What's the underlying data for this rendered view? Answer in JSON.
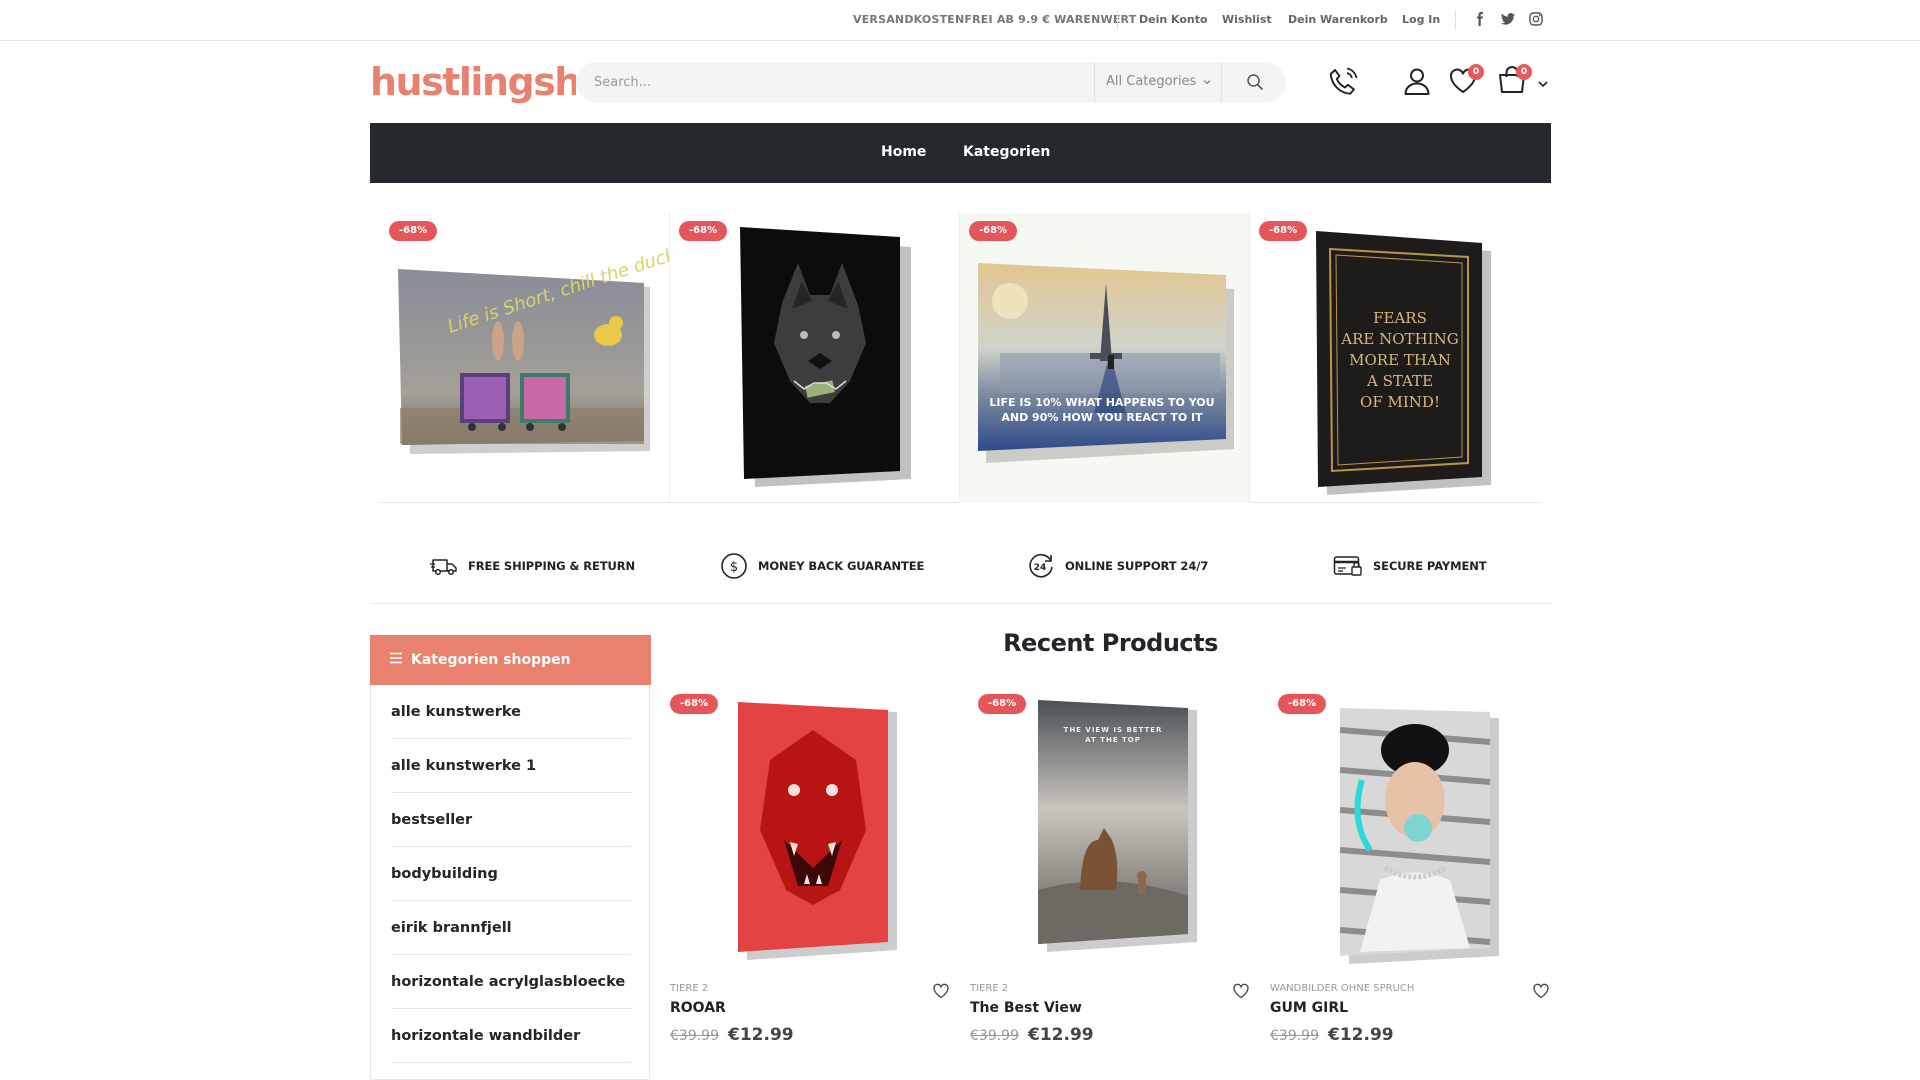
{
  "topbar": {
    "shipping_note": "VERSANDKOSTENFREI AB 9.9 € WARENWERT",
    "links": [
      "Dein Konto",
      "Wishlist",
      "Dein Warenkorb",
      "Log In"
    ],
    "social": [
      "facebook-icon",
      "twitter-icon",
      "instagram-icon"
    ]
  },
  "header": {
    "logo": "hustlingsha",
    "search_placeholder": "Search...",
    "category_select": "All Categories",
    "wishlist_count": "0",
    "cart_count": "0"
  },
  "nav": {
    "items": [
      "Home",
      "Kategorien"
    ]
  },
  "top_products": [
    {
      "badge": "-68%",
      "art": "Life is Short, chill the duck out"
    },
    {
      "badge": "-68%",
      "art": ""
    },
    {
      "badge": "-68%",
      "art": "LIFE IS 10% WHAT HAPPENS TO YOU AND 90% HOW YOU REACT TO IT"
    },
    {
      "badge": "-68%",
      "art": "FEARS ARE NOTHING MORE THAN A STATE OF MIND!"
    }
  ],
  "features": [
    {
      "icon": "truck-icon",
      "label": "FREE SHIPPING & RETURN"
    },
    {
      "icon": "dollar-circle-icon",
      "label": "MONEY BACK GUARANTEE"
    },
    {
      "icon": "support-24-icon",
      "label": "ONLINE SUPPORT 24/7"
    },
    {
      "icon": "credit-card-icon",
      "label": "SECURE PAYMENT"
    }
  ],
  "sidebar": {
    "title": "Kategorien shoppen",
    "items": [
      "alle kunstwerke",
      "alle kunstwerke 1",
      "bestseller",
      "bodybuilding",
      "eirik brannfjell",
      "horizontale acrylglasbloecke",
      "horizontale wandbilder"
    ]
  },
  "recent": {
    "title": "Recent Products",
    "products": [
      {
        "badge": "-68%",
        "category": "TIERE 2",
        "name": "ROOAR",
        "old_price": "€39.99",
        "price": "€12.99"
      },
      {
        "badge": "-68%",
        "category": "TIERE 2",
        "name": "The Best View",
        "old_price": "€39.99",
        "price": "€12.99",
        "art": "THE VIEW IS BETTER AT THE TOP"
      },
      {
        "badge": "-68%",
        "category": "WANDBILDER OHNE SPRUCH",
        "name": "GUM GIRL",
        "old_price": "€39.99",
        "price": "€12.99"
      }
    ]
  },
  "colors": {
    "accent": "#e8826e",
    "nav_bg": "#25282c",
    "sale_badge": "#e5565a"
  }
}
